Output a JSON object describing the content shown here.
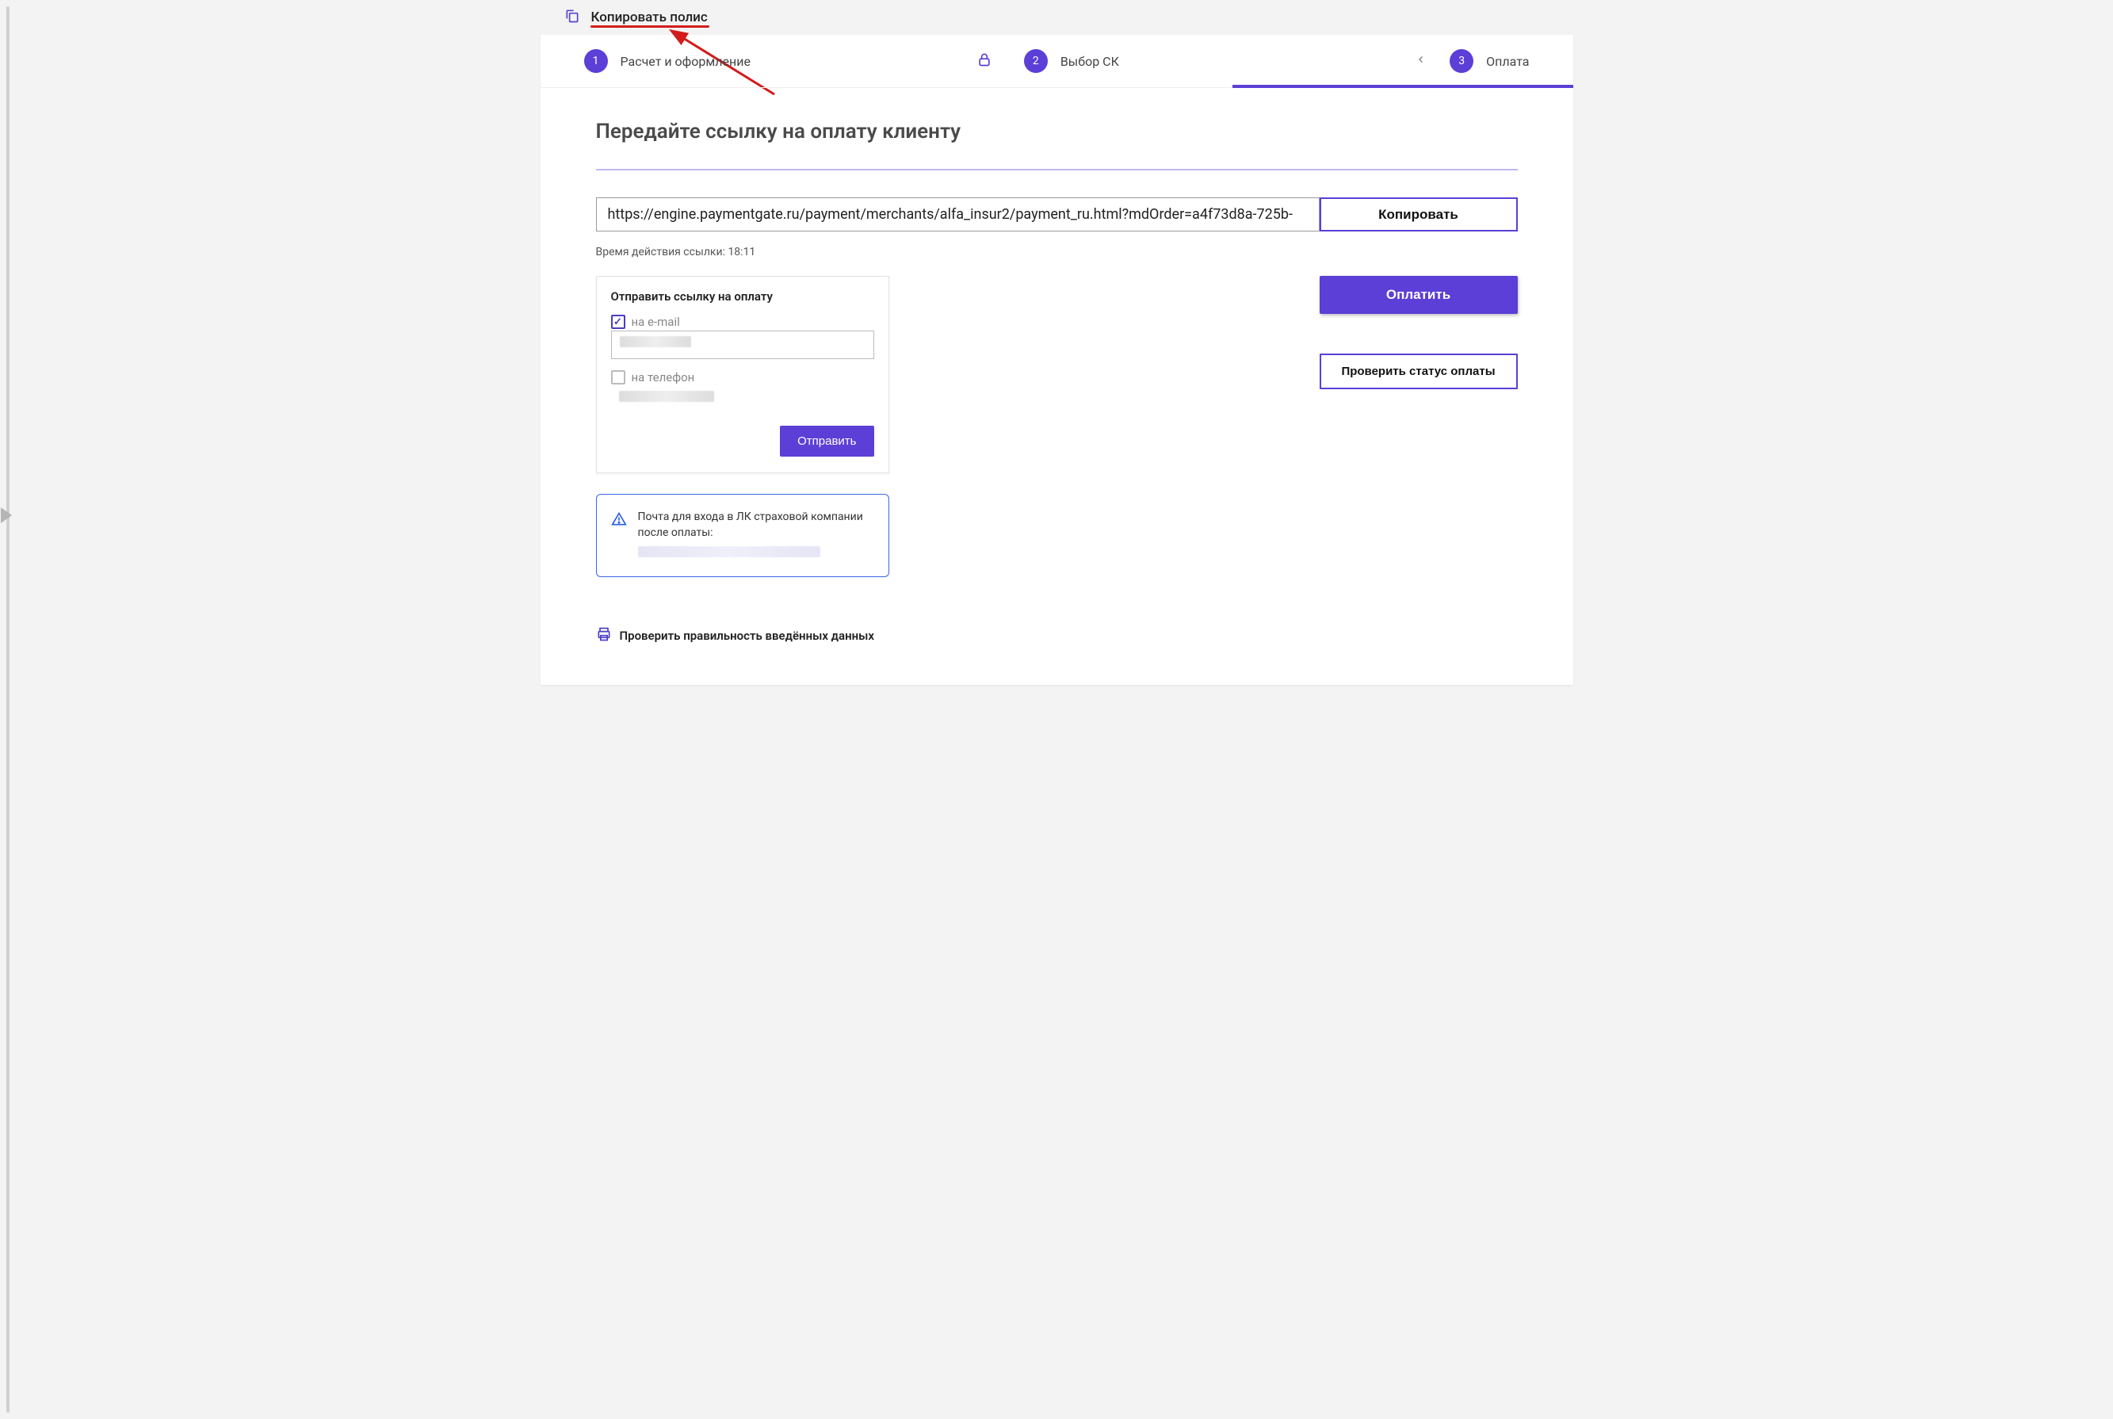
{
  "topbar": {
    "copy_policy": "Копировать полис"
  },
  "steps": {
    "s1": {
      "num": "1",
      "label": "Расчет и оформление"
    },
    "s2": {
      "num": "2",
      "label": "Выбор СК"
    },
    "s3": {
      "num": "3",
      "label": "Оплата"
    }
  },
  "main": {
    "title": "Передайте ссылку на оплату клиенту",
    "url": "https://engine.paymentgate.ru/payment/merchants/alfa_insur2/payment_ru.html?mdOrder=a4f73d8a-725b-",
    "copy_button": "Копировать",
    "timer_prefix": "Время действия ссылки: ",
    "timer_value": "18:11"
  },
  "send_panel": {
    "title": "Отправить ссылку на оплату",
    "email_label": "на e-mail",
    "phone_label": "на телефон",
    "send_button": "Отправить"
  },
  "right": {
    "pay": "Оплатить",
    "check_status": "Проверить статус оплаты"
  },
  "info_box": {
    "text": "Почта для входа в ЛК страховой компании после оплаты:"
  },
  "footer": {
    "verify": "Проверить правильность введённых данных"
  }
}
